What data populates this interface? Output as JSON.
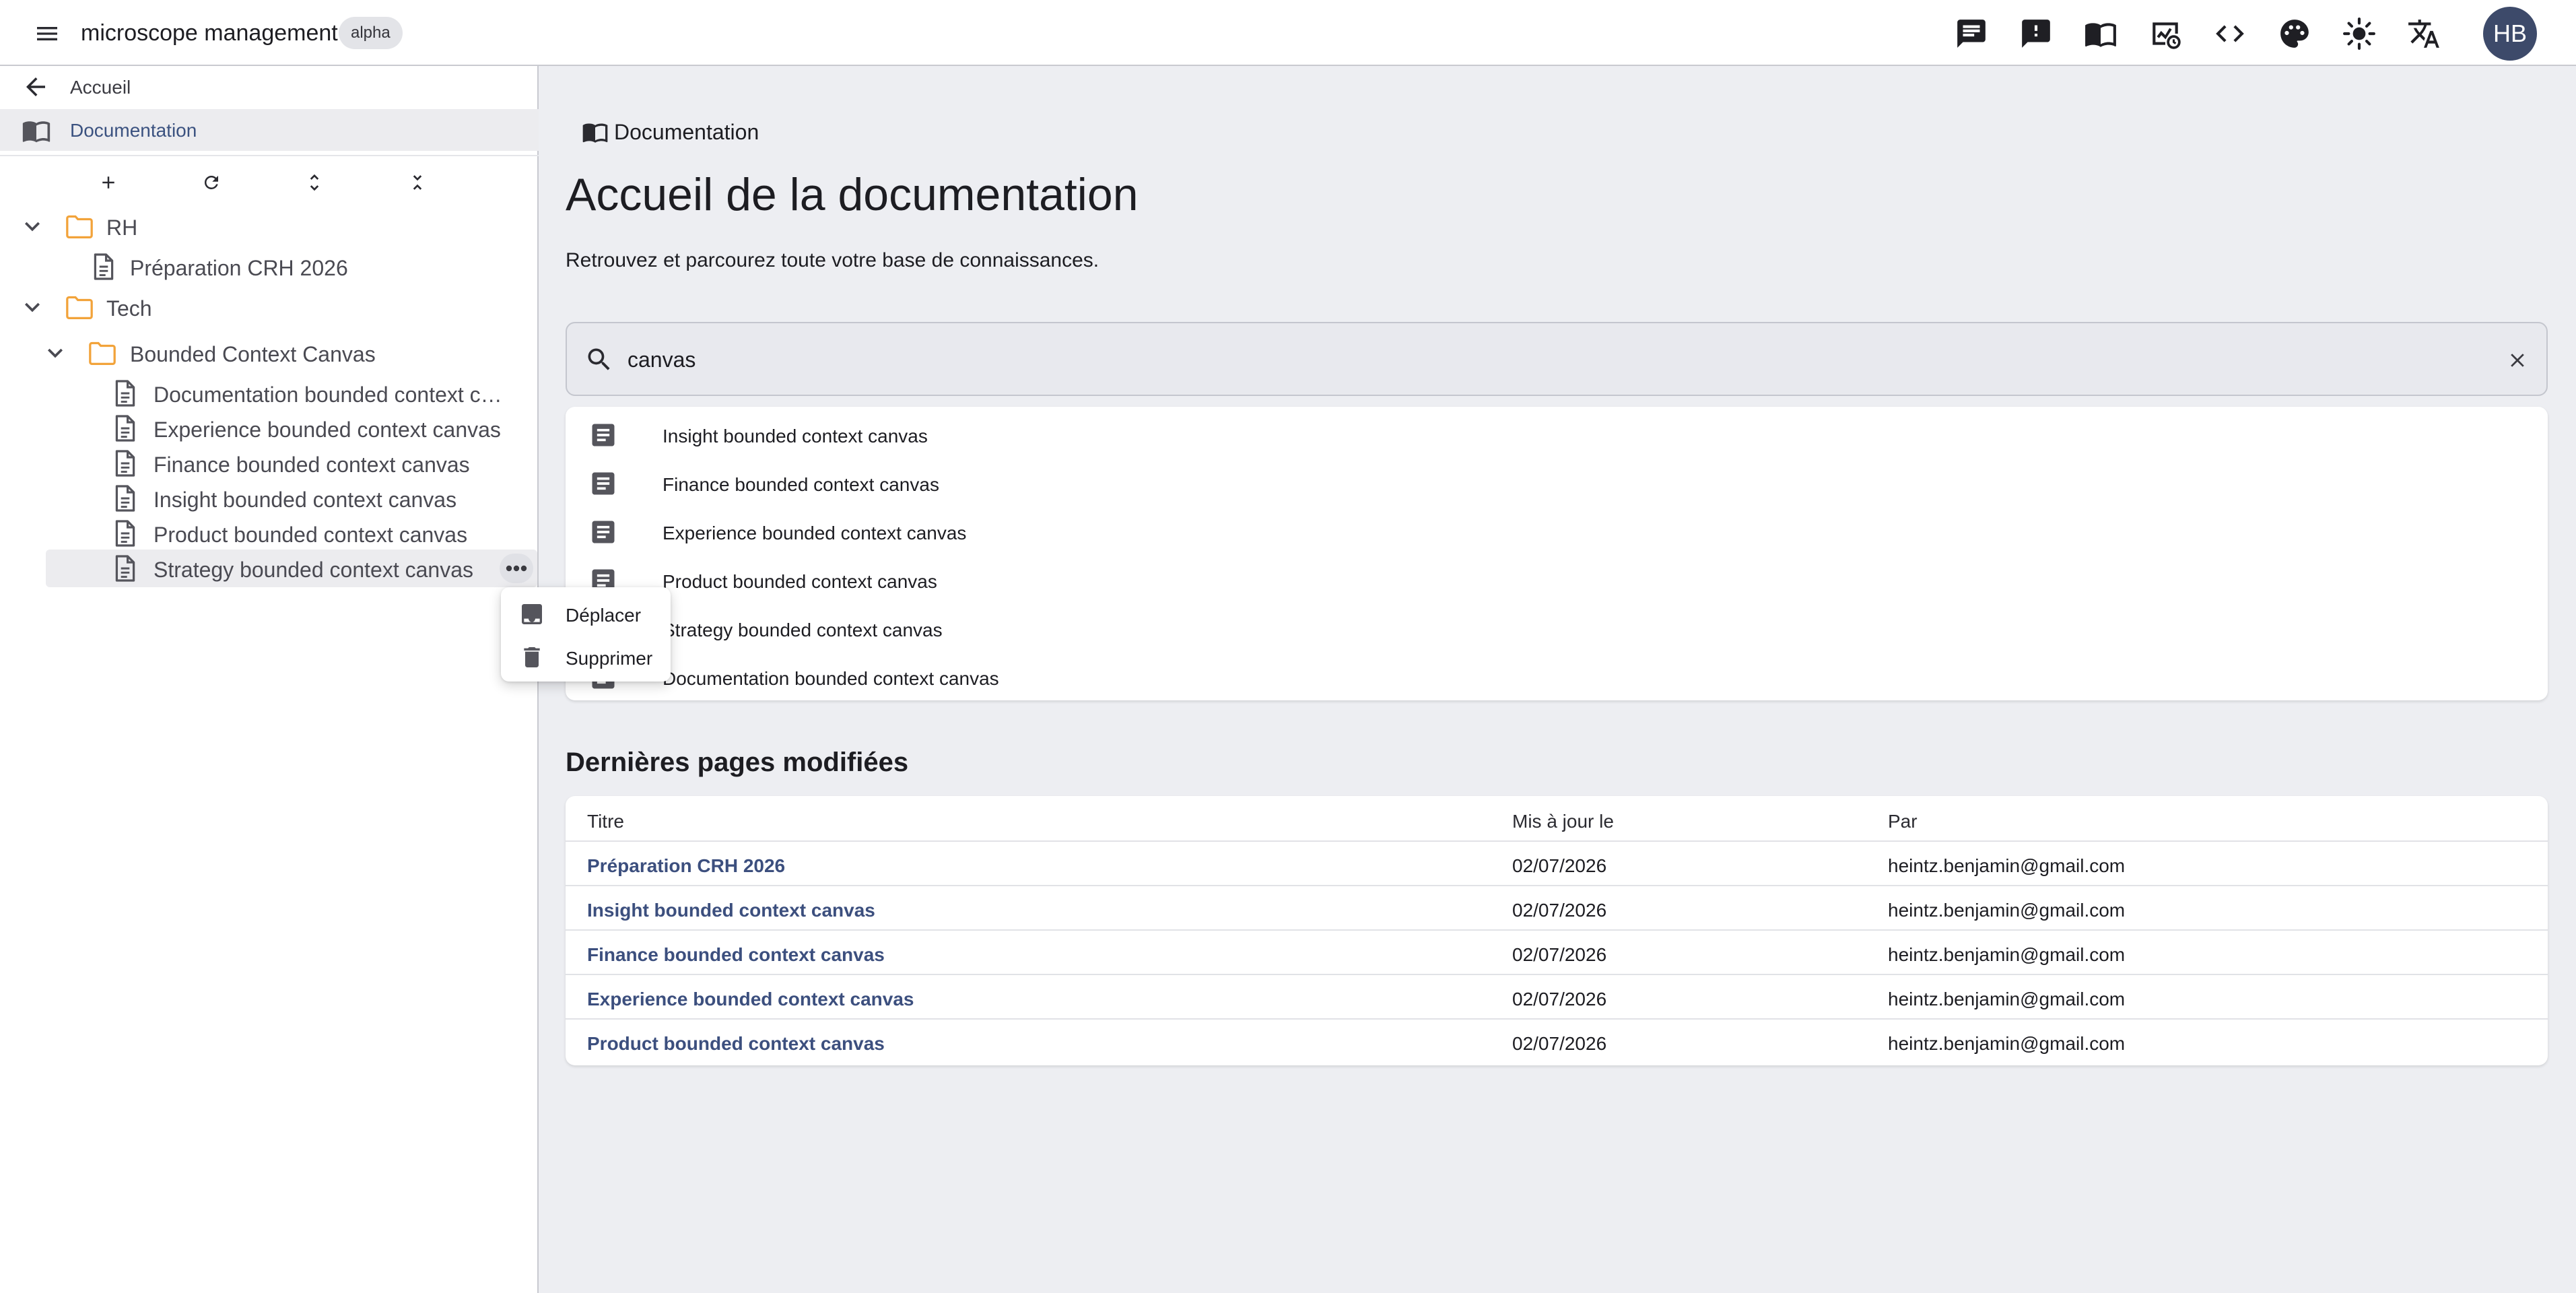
{
  "header": {
    "app_title": "microscope management",
    "badge": "alpha",
    "icons": [
      "chat-icon",
      "feedback-icon",
      "documentation-icon",
      "analytics-icon",
      "code-icon",
      "palette-icon",
      "brightness-icon",
      "translate-icon"
    ],
    "avatar_initials": "HB"
  },
  "sidebar": {
    "back_label": "Accueil",
    "section_label": "Documentation",
    "tree": {
      "rh": "RH",
      "rh_children": [
        "Préparation CRH 2026"
      ],
      "tech": "Tech",
      "bounded": "Bounded Context Canvas",
      "bounded_children": [
        "Documentation bounded context canvas",
        "Experience bounded context canvas",
        "Finance bounded context canvas",
        "Insight bounded context canvas",
        "Product bounded context canvas",
        "Strategy bounded context canvas"
      ]
    },
    "context_menu": {
      "move": "Déplacer",
      "delete": "Supprimer"
    }
  },
  "main": {
    "breadcrumb": "Documentation",
    "title": "Accueil de la documentation",
    "subtitle": "Retrouvez et parcourez toute votre base de connaissances.",
    "search": {
      "value": "canvas"
    },
    "results": [
      "Insight bounded context canvas",
      "Finance bounded context canvas",
      "Experience bounded context canvas",
      "Product bounded context canvas",
      "Strategy bounded context canvas",
      "Documentation bounded context canvas"
    ],
    "recent_title": "Dernières pages modifiées",
    "table": {
      "headers": [
        "Titre",
        "Mis à jour le",
        "Par"
      ],
      "rows": [
        {
          "title": "Préparation CRH 2026",
          "date": "02/07/2026",
          "by": "heintz.benjamin@gmail.com"
        },
        {
          "title": "Insight bounded context canvas",
          "date": "02/07/2026",
          "by": "heintz.benjamin@gmail.com"
        },
        {
          "title": "Finance bounded context canvas",
          "date": "02/07/2026",
          "by": "heintz.benjamin@gmail.com"
        },
        {
          "title": "Experience bounded context canvas",
          "date": "02/07/2026",
          "by": "heintz.benjamin@gmail.com"
        },
        {
          "title": "Product bounded context canvas",
          "date": "02/07/2026",
          "by": "heintz.benjamin@gmail.com"
        }
      ]
    }
  },
  "colors": {
    "accent": "#3c4f7e",
    "folder": "#f2a33a",
    "avatar_bg": "#3d4a6a"
  }
}
